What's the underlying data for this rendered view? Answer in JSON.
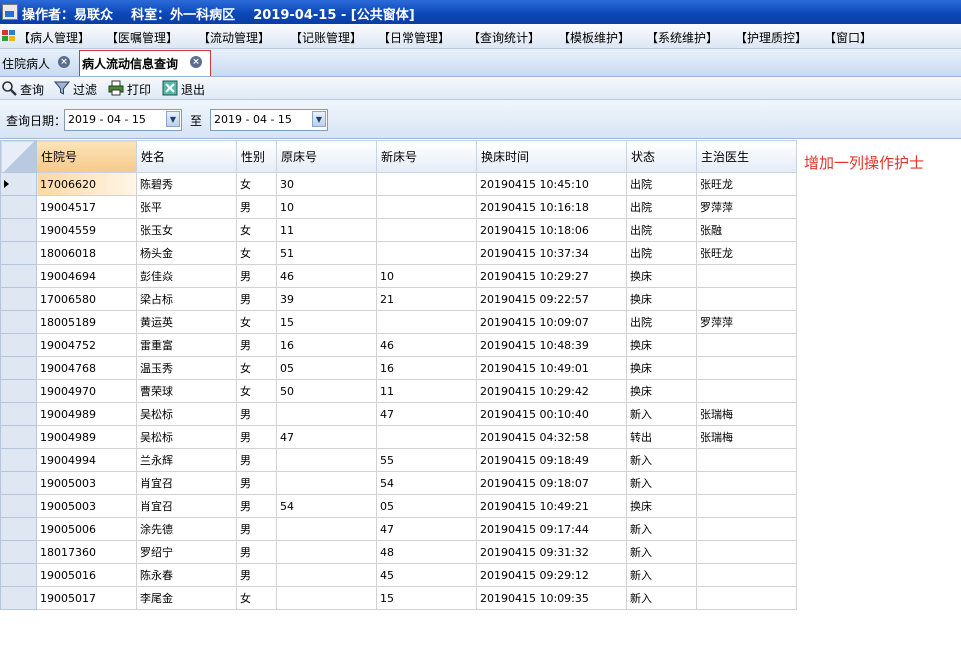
{
  "window": {
    "title": "操作者：易联众    科室：外一科病区    2019-04-15 - [公共窗体]"
  },
  "menu": [
    "【病人管理】",
    "【医嘱管理】",
    "【流动管理】",
    "【记账管理】",
    "【日常管理】",
    "【查询统计】",
    "【模板维护】",
    "【系统维护】",
    "【护理质控】",
    "【窗口】"
  ],
  "tabs": [
    {
      "label": "住院病人",
      "active": false
    },
    {
      "label": "病人流动信息查询",
      "active": true
    }
  ],
  "toolbar": {
    "query": "查询",
    "filter": "过滤",
    "print": "打印",
    "exit": "退出"
  },
  "filter": {
    "label": "查询日期：",
    "date_from": "2019 - 04 - 15",
    "to_label": "至",
    "date_to": "2019 - 04 - 15"
  },
  "table": {
    "columns": [
      "住院号",
      "姓名",
      "性别",
      "原床号",
      "新床号",
      "换床时间",
      "状态",
      "主治医生"
    ],
    "rows": [
      [
        "17006620",
        "陈碧秀",
        "女",
        "30",
        "",
        "20190415 10:45:10",
        "出院",
        "张旺龙"
      ],
      [
        "19004517",
        "张平",
        "男",
        "10",
        "",
        "20190415 10:16:18",
        "出院",
        "罗萍萍"
      ],
      [
        "19004559",
        "张玉女",
        "女",
        "11",
        "",
        "20190415 10:18:06",
        "出院",
        "张融"
      ],
      [
        "18006018",
        "杨头金",
        "女",
        "51",
        "",
        "20190415 10:37:34",
        "出院",
        "张旺龙"
      ],
      [
        "19004694",
        "彭佳焱",
        "男",
        "46",
        "10",
        "20190415 10:29:27",
        "换床",
        ""
      ],
      [
        "17006580",
        "梁占标",
        "男",
        "39",
        "21",
        "20190415 09:22:57",
        "换床",
        ""
      ],
      [
        "18005189",
        "黄运英",
        "女",
        "15",
        "",
        "20190415 10:09:07",
        "出院",
        "罗萍萍"
      ],
      [
        "19004752",
        "雷重富",
        "男",
        "16",
        "46",
        "20190415 10:48:39",
        "换床",
        ""
      ],
      [
        "19004768",
        "温玉秀",
        "女",
        "05",
        "16",
        "20190415 10:49:01",
        "换床",
        ""
      ],
      [
        "19004970",
        "曹荣球",
        "女",
        "50",
        "11",
        "20190415 10:29:42",
        "换床",
        ""
      ],
      [
        "19004989",
        "吴松标",
        "男",
        "",
        "47",
        "20190415 00:10:40",
        "新入",
        "张瑞梅"
      ],
      [
        "19004989",
        "吴松标",
        "男",
        "47",
        "",
        "20190415 04:32:58",
        "转出",
        "张瑞梅"
      ],
      [
        "19004994",
        "兰永辉",
        "男",
        "",
        "55",
        "20190415 09:18:49",
        "新入",
        ""
      ],
      [
        "19005003",
        "肖宜召",
        "男",
        "",
        "54",
        "20190415 09:18:07",
        "新入",
        ""
      ],
      [
        "19005003",
        "肖宜召",
        "男",
        "54",
        "05",
        "20190415 10:49:21",
        "换床",
        ""
      ],
      [
        "19005006",
        "涂先德",
        "男",
        "",
        "47",
        "20190415 09:17:44",
        "新入",
        ""
      ],
      [
        "18017360",
        "罗绍宁",
        "男",
        "",
        "48",
        "20190415 09:31:32",
        "新入",
        ""
      ],
      [
        "19005016",
        "陈永春",
        "男",
        "",
        "45",
        "20190415 09:29:12",
        "新入",
        ""
      ],
      [
        "19005017",
        "李尾金",
        "女",
        "",
        "15",
        "20190415 10:09:35",
        "新入",
        ""
      ]
    ]
  },
  "note": "增加一列操作护士",
  "colors": {
    "titlebar": "#0d48b8",
    "selection": "#fcd8a4",
    "note": "#e0352a",
    "active_tab_border": "#cc3a3a"
  }
}
